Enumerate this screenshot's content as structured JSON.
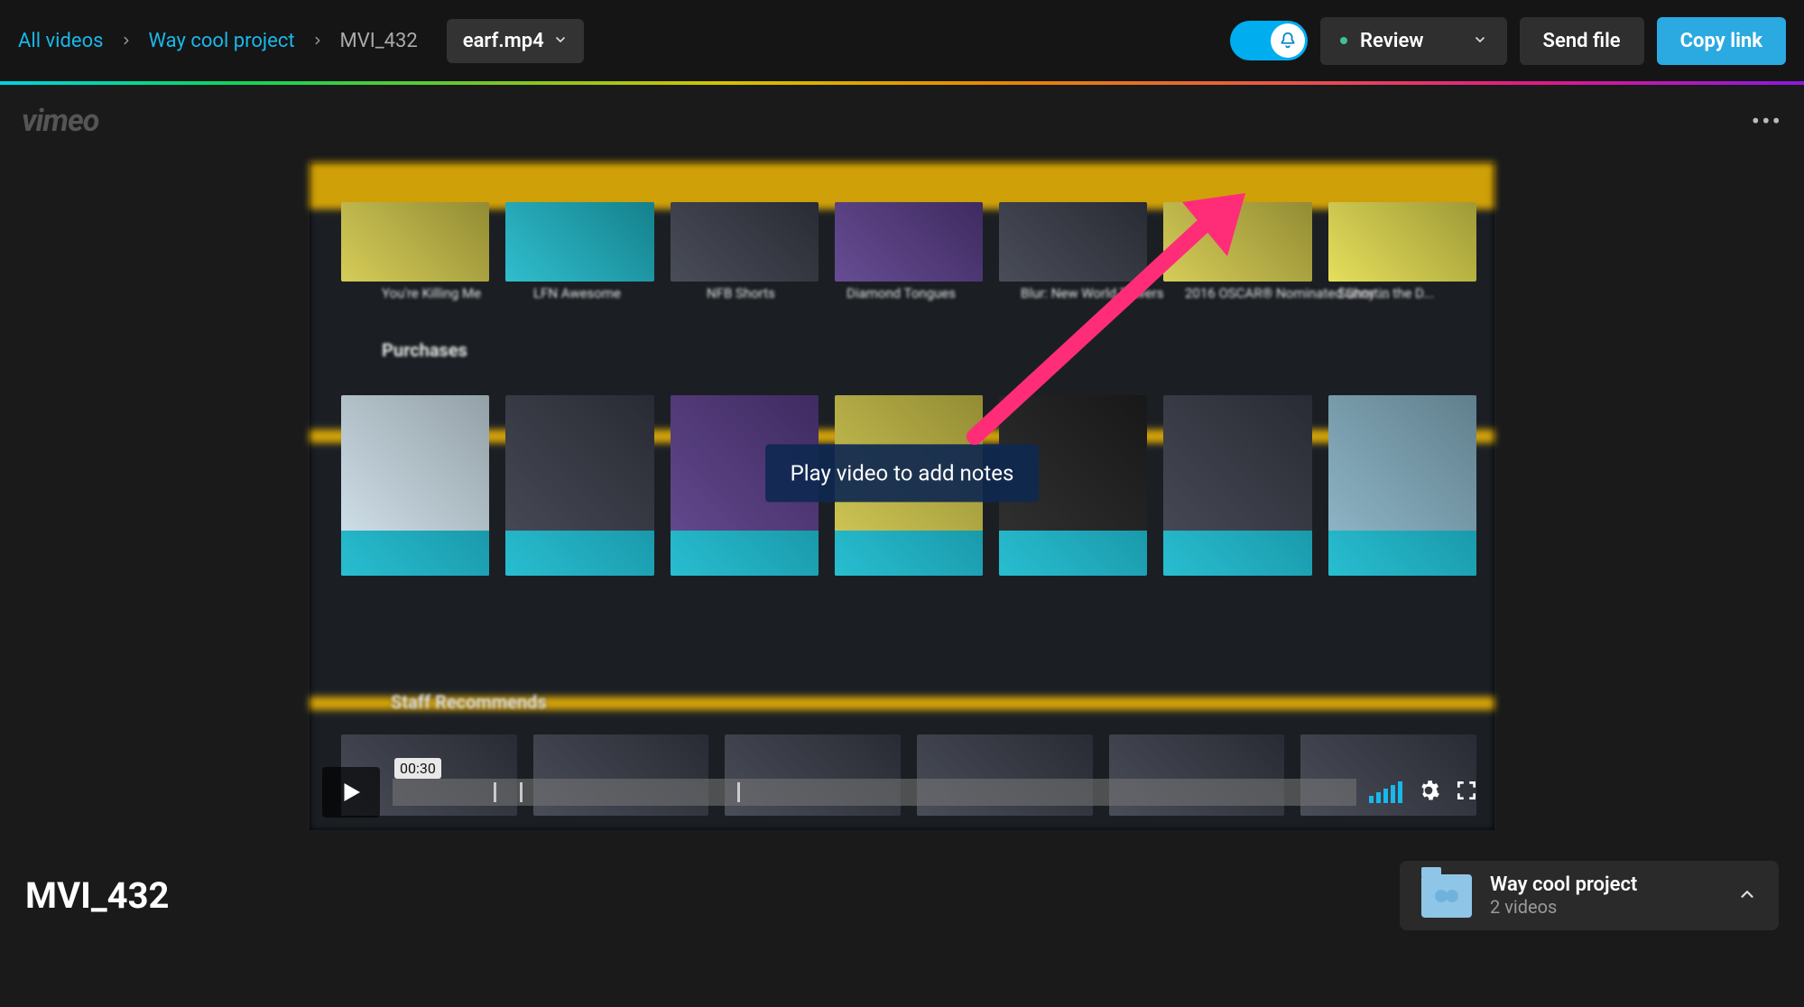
{
  "breadcrumb": {
    "root": "All videos",
    "project": "Way cool project",
    "item": "MVI_432"
  },
  "file_dropdown": "earf.mp4",
  "notification_toggle_on": true,
  "actions": {
    "review": "Review",
    "send": "Send file",
    "copy": "Copy link"
  },
  "brand": "vimeo",
  "video_overlay_tip": "Play video to add notes",
  "player": {
    "time_bubble": "00:30",
    "ticks_pct": [
      10.5,
      13.2,
      35.8
    ]
  },
  "video_content": {
    "row1_labels": [
      "You're Killing Me",
      "LFN Awesome",
      "NFB Shorts",
      "Diamond Tongues",
      "Blur: New World Towers",
      "2016 OSCAR® Nominated Short...",
      "Sunny in the D..."
    ],
    "section_purchases": "Purchases",
    "section_staff": "Staff Recommends"
  },
  "title": "MVI_432",
  "project_card": {
    "name": "Way cool project",
    "meta": "2 videos"
  }
}
